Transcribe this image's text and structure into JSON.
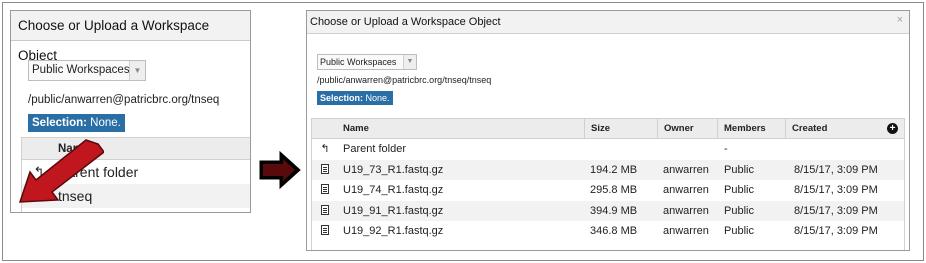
{
  "left": {
    "title": "Choose or Upload a Workspace Object",
    "workspace_select": "Public Workspaces",
    "path": "/public/anwarren@patricbrc.org/tnseq",
    "selection_label": "Selection:",
    "selection_value": "None.",
    "column_name": "Name",
    "rows": [
      {
        "icon": "up-arrow-icon",
        "name": "Parent folder"
      },
      {
        "icon": "folder-icon",
        "name": "tnseq"
      }
    ]
  },
  "right": {
    "title": "Choose or Upload a Workspace Object",
    "close_glyph": "×",
    "workspace_select": "Public Workspaces",
    "path": "/public/anwarren@patricbrc.org/tnseq/tnseq",
    "selection_label": "Selection:",
    "selection_value": "None.",
    "columns": [
      "Name",
      "Size",
      "Owner",
      "Members",
      "Created"
    ],
    "add_glyph": "+",
    "parent_row": {
      "name": "Parent folder",
      "members": "-"
    },
    "files": [
      {
        "name": "U19_73_R1.fastq.gz",
        "size": "194.2 MB",
        "owner": "anwarren",
        "members": "Public",
        "created": "8/15/17, 3:09 PM"
      },
      {
        "name": "U19_74_R1.fastq.gz",
        "size": "295.8 MB",
        "owner": "anwarren",
        "members": "Public",
        "created": "8/15/17, 3:09 PM"
      },
      {
        "name": "U19_91_R1.fastq.gz",
        "size": "394.9 MB",
        "owner": "anwarren",
        "members": "Public",
        "created": "8/15/17, 3:09 PM"
      },
      {
        "name": "U19_92_R1.fastq.gz",
        "size": "346.8 MB",
        "owner": "anwarren",
        "members": "Public",
        "created": "8/15/17, 3:09 PM"
      }
    ]
  },
  "colors": {
    "selection_badge": "#2a6ea6",
    "red_arrow": "#c0161d",
    "black_arrow": "#000000"
  }
}
